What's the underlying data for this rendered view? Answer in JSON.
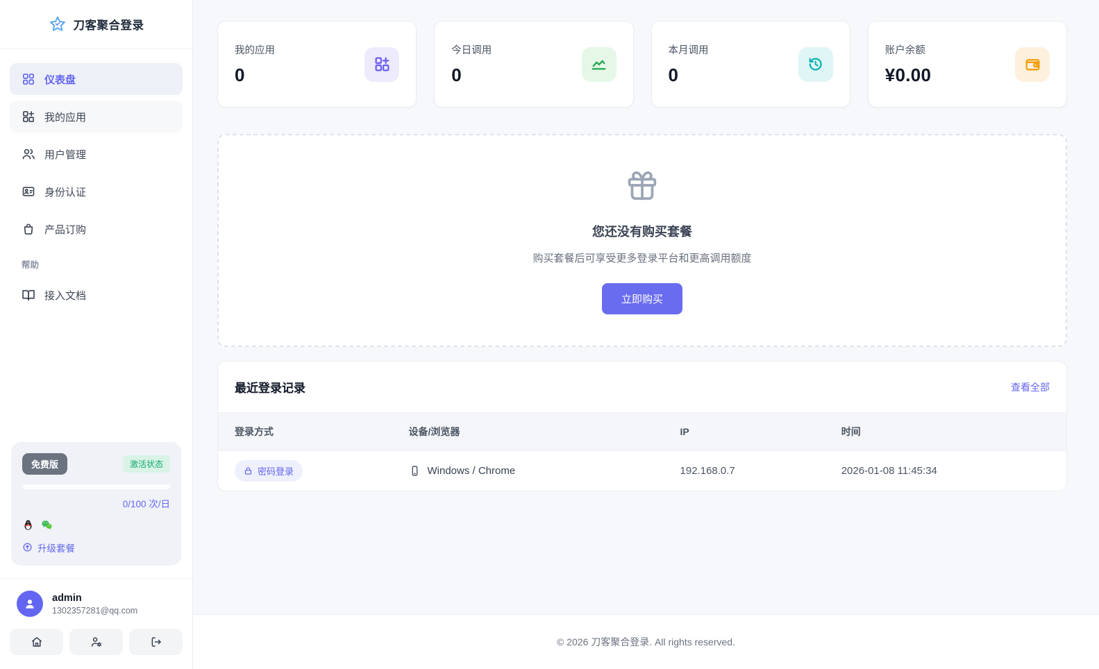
{
  "app": {
    "title": "刀客聚合登录"
  },
  "sidebar": {
    "menu": [
      {
        "label": "仪表盘",
        "icon": "dashboard-icon",
        "active": true
      },
      {
        "label": "我的应用",
        "icon": "apps-plus-icon",
        "active": false
      },
      {
        "label": "用户管理",
        "icon": "users-icon",
        "active": false
      },
      {
        "label": "身份认证",
        "icon": "id-card-icon",
        "active": false
      },
      {
        "label": "产品订购",
        "icon": "shopping-bag-icon",
        "active": false
      }
    ],
    "help_section_label": "帮助",
    "help_menu": [
      {
        "label": "接入文档",
        "icon": "book-open-icon"
      }
    ],
    "plan": {
      "name": "免费版",
      "status": "激活状态",
      "quota": "0/100 次/日",
      "platform_icons": [
        "qq-icon",
        "wechat-icon"
      ],
      "upgrade_label": "升级套餐",
      "accent_color": "#6366f1",
      "status_color": "#12a970"
    },
    "user": {
      "name": "admin",
      "email": "1302357281@qq.com"
    },
    "action_icons": [
      "home-icon",
      "user-gear-icon",
      "logout-icon"
    ]
  },
  "stats": [
    {
      "label": "我的应用",
      "value": "0",
      "icon": "apps-plus-icon",
      "color": "#6c5ff1",
      "bg": "#edebfc"
    },
    {
      "label": "今日调用",
      "value": "0",
      "icon": "chart-line-icon",
      "color": "#21a84e",
      "bg": "#e5f7e7"
    },
    {
      "label": "本月调用",
      "value": "0",
      "icon": "history-icon",
      "color": "#11b3b3",
      "bg": "#e0f5f5"
    },
    {
      "label": "账户余额",
      "value": "¥0.00",
      "icon": "wallet-icon",
      "color": "#f59e0b",
      "bg": "#fdf1de"
    }
  ],
  "empty_plan": {
    "icon": "gift-icon",
    "title": "您还没有购买套餐",
    "subtitle": "购买套餐后可享受更多登录平台和更高调用额度",
    "button_label": "立即购买",
    "button_color": "#6a6cf0"
  },
  "recent_logins": {
    "title": "最近登录记录",
    "view_all_label": "查看全部",
    "columns": [
      "登录方式",
      "设备/浏览器",
      "IP",
      "时间"
    ],
    "rows": [
      {
        "method": "密码登录",
        "method_icon": "lock-icon",
        "device": "Windows / Chrome",
        "device_icon": "mobile-icon",
        "ip": "192.168.0.7",
        "time": "2026-01-08 11:45:34"
      }
    ]
  },
  "footer": {
    "copyright": "© 2026 刀客聚合登录. All rights reserved."
  }
}
